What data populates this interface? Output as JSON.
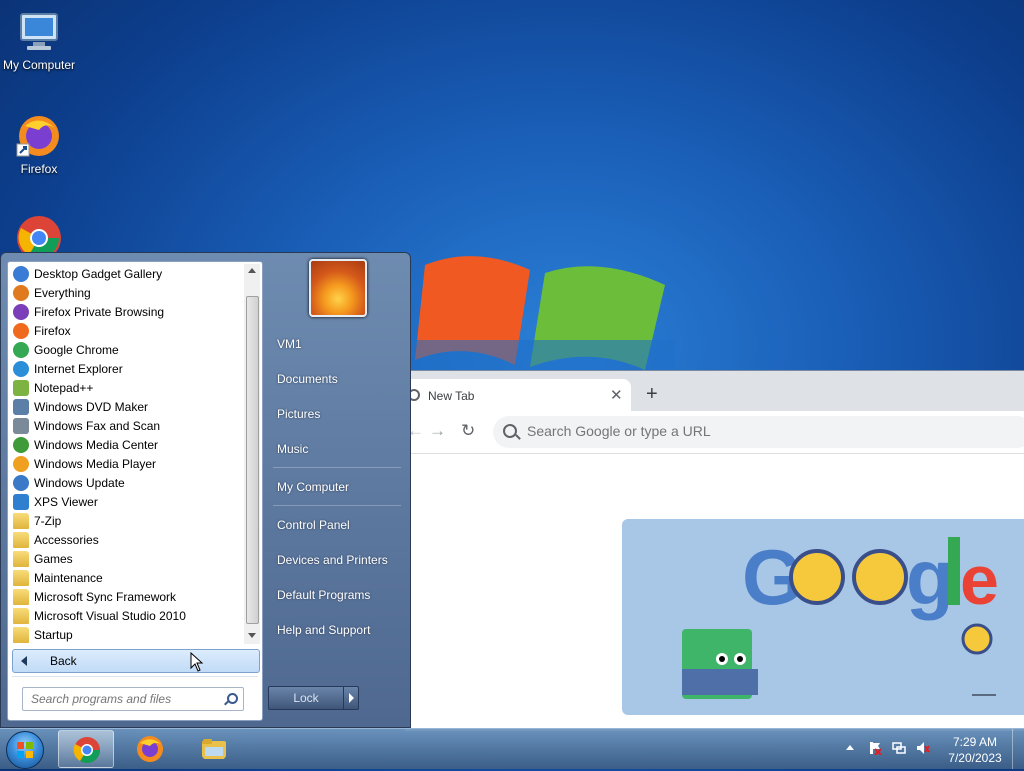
{
  "desktop": {
    "icons": [
      {
        "label": "My Computer",
        "icon": "computer-icon"
      },
      {
        "label": "Firefox",
        "icon": "firefox-icon"
      },
      {
        "label": "",
        "icon": "chrome-icon"
      }
    ]
  },
  "chrome": {
    "tab_title": "New Tab",
    "omnibox_placeholder": "Search Google or type a URL"
  },
  "start_menu": {
    "programs": [
      {
        "label": "Desktop Gadget Gallery",
        "icon": "gadget-icon",
        "color": "#3a7bd5"
      },
      {
        "label": "Everything",
        "icon": "magnifier-icon",
        "color": "#e07a1e"
      },
      {
        "label": "Firefox Private Browsing",
        "icon": "firefox-private-icon",
        "color": "#7a3fb8"
      },
      {
        "label": "Firefox",
        "icon": "firefox-icon",
        "color": "#f06a1d"
      },
      {
        "label": "Google Chrome",
        "icon": "chrome-icon",
        "color": "#34a853"
      },
      {
        "label": "Internet Explorer",
        "icon": "ie-icon",
        "color": "#2a8fd8"
      },
      {
        "label": "Notepad++",
        "icon": "notepad-icon",
        "color": "#7cb342"
      },
      {
        "label": "Windows DVD Maker",
        "icon": "dvd-icon",
        "color": "#5c7fa8"
      },
      {
        "label": "Windows Fax and Scan",
        "icon": "fax-icon",
        "color": "#7a8a99"
      },
      {
        "label": "Windows Media Center",
        "icon": "media-center-icon",
        "color": "#3f9a3a"
      },
      {
        "label": "Windows Media Player",
        "icon": "media-player-icon",
        "color": "#f0a020"
      },
      {
        "label": "Windows Update",
        "icon": "update-icon",
        "color": "#3a78c8"
      },
      {
        "label": "XPS Viewer",
        "icon": "xps-icon",
        "color": "#2f7fd0"
      },
      {
        "label": "7-Zip",
        "icon": "folder-icon",
        "color": "#e8c04a"
      },
      {
        "label": "Accessories",
        "icon": "folder-icon",
        "color": "#e8c04a"
      },
      {
        "label": "Games",
        "icon": "folder-icon",
        "color": "#e8c04a"
      },
      {
        "label": "Maintenance",
        "icon": "folder-icon",
        "color": "#e8c04a"
      },
      {
        "label": "Microsoft Sync Framework",
        "icon": "folder-icon",
        "color": "#e8c04a"
      },
      {
        "label": "Microsoft Visual Studio 2010",
        "icon": "folder-icon",
        "color": "#e8c04a"
      },
      {
        "label": "Startup",
        "icon": "folder-icon",
        "color": "#e8c04a"
      }
    ],
    "back_label": "Back",
    "search_placeholder": "Search programs and files",
    "right_items": [
      "VM1",
      "Documents",
      "Pictures",
      "Music",
      "My Computer",
      "Control Panel",
      "Devices and Printers",
      "Default Programs",
      "Help and Support"
    ],
    "lock_label": "Lock"
  },
  "taskbar": {
    "pinned": [
      "chrome-icon",
      "firefox-icon",
      "explorer-icon"
    ],
    "time": "7:29 AM",
    "date": "7/20/2023"
  }
}
